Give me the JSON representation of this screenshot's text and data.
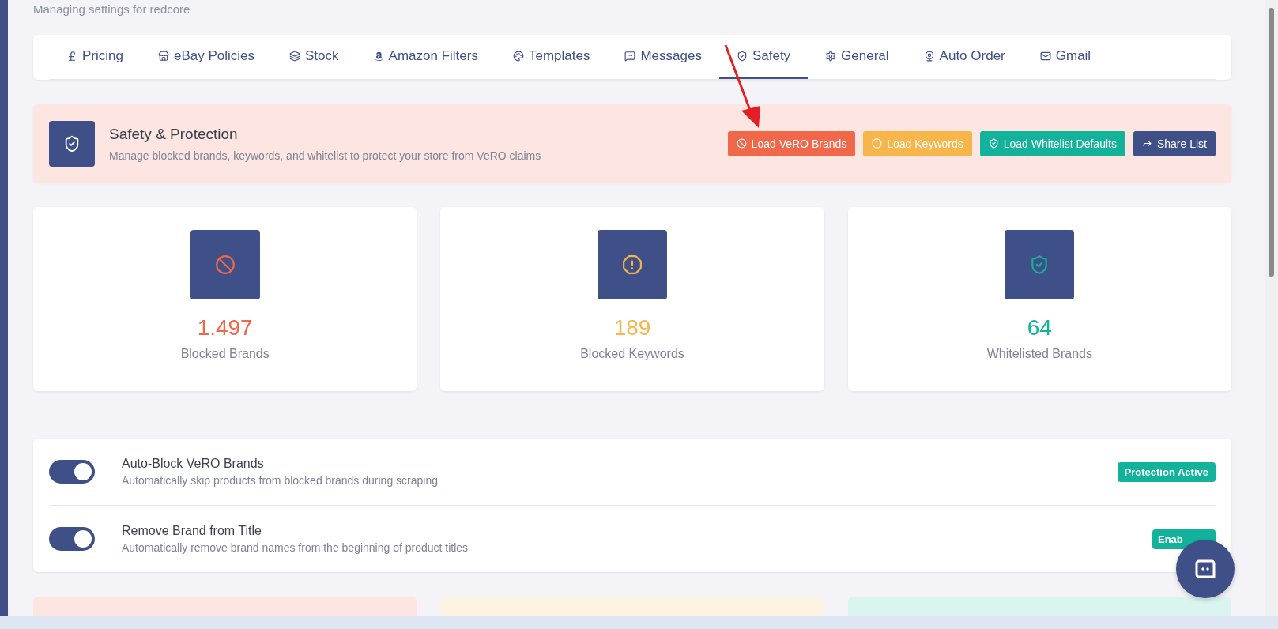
{
  "page": {
    "subtitle": "Managing settings for redcore"
  },
  "tabs": [
    {
      "label": "Pricing",
      "selected": false
    },
    {
      "label": "eBay Policies",
      "selected": false
    },
    {
      "label": "Stock",
      "selected": false
    },
    {
      "label": "Amazon Filters",
      "selected": false
    },
    {
      "label": "Templates",
      "selected": false
    },
    {
      "label": "Messages",
      "selected": false
    },
    {
      "label": "Safety",
      "selected": true
    },
    {
      "label": "General",
      "selected": false
    },
    {
      "label": "Auto Order",
      "selected": false
    },
    {
      "label": "Gmail",
      "selected": false
    }
  ],
  "banner": {
    "title": "Safety & Protection",
    "description": "Manage blocked brands, keywords, and whitelist to protect your store from VeRO claims",
    "buttons": [
      {
        "label": "Load VeRO Brands",
        "color": "#f0674a"
      },
      {
        "label": "Load Keywords",
        "color": "#f7b54a"
      },
      {
        "label": "Load Whitelist Defaults",
        "color": "#12b39a"
      },
      {
        "label": "Share List",
        "color": "#3f4f87"
      }
    ]
  },
  "stats": [
    {
      "value": "1.497",
      "label": "Blocked Brands",
      "color": "#f0674a"
    },
    {
      "value": "189",
      "label": "Blocked Keywords",
      "color": "#f7b54a"
    },
    {
      "value": "64",
      "label": "Whitelisted Brands",
      "color": "#12b39a"
    }
  ],
  "settings": [
    {
      "title": "Auto-Block VeRO Brands",
      "description": "Automatically skip products from blocked brands during scraping",
      "on": true,
      "badge": "Protection Active"
    },
    {
      "title": "Remove Brand from Title",
      "description": "Automatically remove brand names from the beginning of product titles",
      "on": true,
      "badge": "Enab"
    }
  ],
  "bottom_cards": [
    {
      "color": "#fde6e2"
    },
    {
      "color": "#fdf3e2"
    },
    {
      "color": "#daf4ee"
    }
  ]
}
